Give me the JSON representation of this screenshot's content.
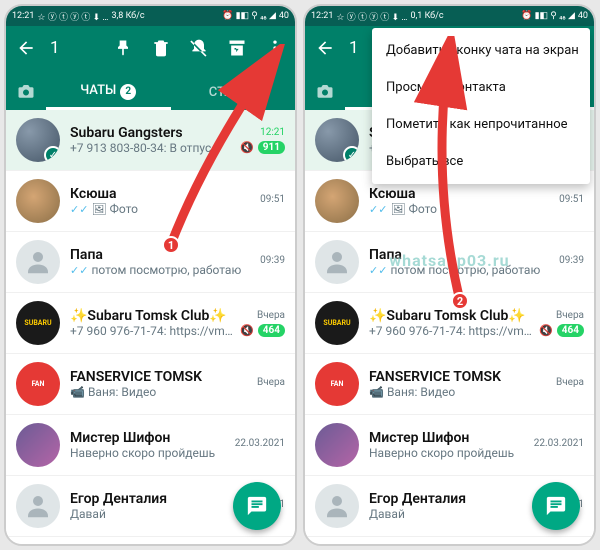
{
  "statusbar": {
    "time": "12:21",
    "net": "3,8 Кб/с",
    "net2": "0,1 Кб/с",
    "batt": "40"
  },
  "topbar": {
    "selected_count": "1"
  },
  "tabs": {
    "chats": "ЧАТЫ",
    "chats_badge": "2",
    "status": "СТАТУС"
  },
  "menu": {
    "items": [
      "Добавить иконку чата на экран",
      "Просмотр контакта",
      "Пометить как непрочитанное",
      "Выбрать все"
    ]
  },
  "chats": [
    {
      "title": "Subaru Gangsters",
      "sub_prefix": "+7 913 803-80-34:",
      "sub": "В отпус…",
      "time": "12:21",
      "unread": "911",
      "muted": true,
      "unread_time": true,
      "avatar": "photo1",
      "selected": true
    },
    {
      "title": "Ксюша",
      "sub": "Фото",
      "sub_icon": "image",
      "ticks": true,
      "time": "09:51",
      "avatar": "photo2"
    },
    {
      "title": "Папа",
      "sub": "потом посмотрю, работаю",
      "ticks": true,
      "time": "09:39",
      "avatar": "grey"
    },
    {
      "title": "✨Subaru Tomsk Club✨",
      "sub_prefix": "+7 960 976-71-74:",
      "sub": "https://vm…",
      "time": "Вчера",
      "unread": "464",
      "muted": true,
      "avatar": "dark",
      "avatar_text": "SUBARU"
    },
    {
      "title": "FANSERVICE TOMSK",
      "sub_prefix": "Ваня:",
      "sub": "Видео",
      "sub_icon": "video",
      "time": "Вчера",
      "avatar": "red",
      "avatar_text": "FAN"
    },
    {
      "title": "Мистер Шифон",
      "sub": "Наверно скоро пройдешь",
      "time": "22.03.2021",
      "avatar": "city"
    },
    {
      "title": "Егор Денталия",
      "sub": "Давай",
      "time": "22.03.2021",
      "avatar": "grey"
    }
  ],
  "watermark": "whatsapp03.ru",
  "step_badges": {
    "left": "1",
    "right": "2"
  }
}
